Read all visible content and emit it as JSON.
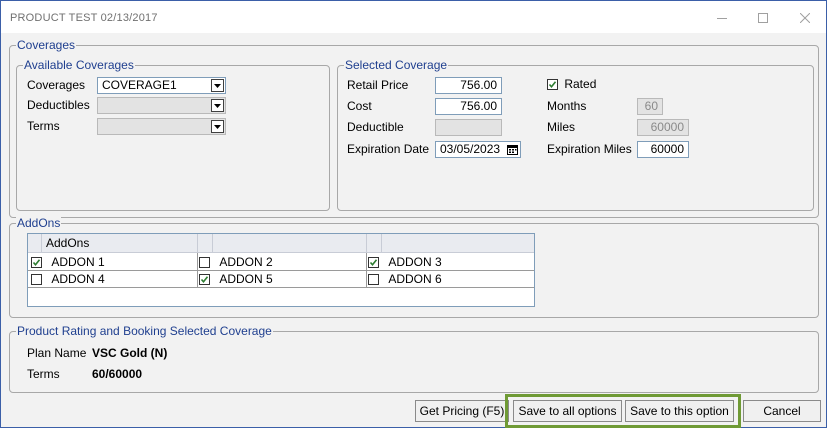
{
  "window": {
    "title": "PRODUCT TEST 02/13/2017",
    "minimize_icon": "minimize-icon",
    "maximize_icon": "maximize-icon",
    "close_icon": "close-icon"
  },
  "coverages": {
    "legend": "Coverages",
    "available": {
      "legend": "Available Coverages",
      "coverages_label": "Coverages",
      "coverages_value": "COVERAGE1",
      "deductibles_label": "Deductibles",
      "deductibles_value": "",
      "terms_label": "Terms",
      "terms_value": ""
    },
    "selected": {
      "legend": "Selected Coverage",
      "retail_price_label": "Retail Price",
      "retail_price_value": "756.00",
      "cost_label": "Cost",
      "cost_value": "756.00",
      "deductible_label": "Deductible",
      "deductible_value": "",
      "expiration_date_label": "Expiration Date",
      "expiration_date_value": "03/05/2023",
      "rated_label": "Rated",
      "rated_checked": true,
      "months_label": "Months",
      "months_value": "60",
      "miles_label": "Miles",
      "miles_value": "60000",
      "expiration_miles_label": "Expiration Miles",
      "expiration_miles_value": "60000"
    }
  },
  "addons": {
    "legend": "AddOns",
    "column_header": "AddOns",
    "rows": [
      [
        {
          "label": "ADDON 1",
          "checked": true
        },
        {
          "label": "ADDON 2",
          "checked": false
        },
        {
          "label": "ADDON 3",
          "checked": true
        }
      ],
      [
        {
          "label": "ADDON 4",
          "checked": false
        },
        {
          "label": "ADDON 5",
          "checked": true
        },
        {
          "label": "ADDON 6",
          "checked": false
        }
      ]
    ]
  },
  "rating": {
    "legend": "Product Rating and Booking Selected Coverage",
    "plan_name_label": "Plan Name",
    "plan_name_value": "VSC Gold (N)",
    "terms_label": "Terms",
    "terms_value": "60/60000"
  },
  "buttons": {
    "get_pricing": "Get Pricing (F5)",
    "save_all": "Save to all options",
    "save_this": "Save to this option",
    "cancel": "Cancel"
  },
  "colors": {
    "accent": "#1f3f8f",
    "highlight": "#6f9a35",
    "window_border": "#3b5fa8"
  }
}
